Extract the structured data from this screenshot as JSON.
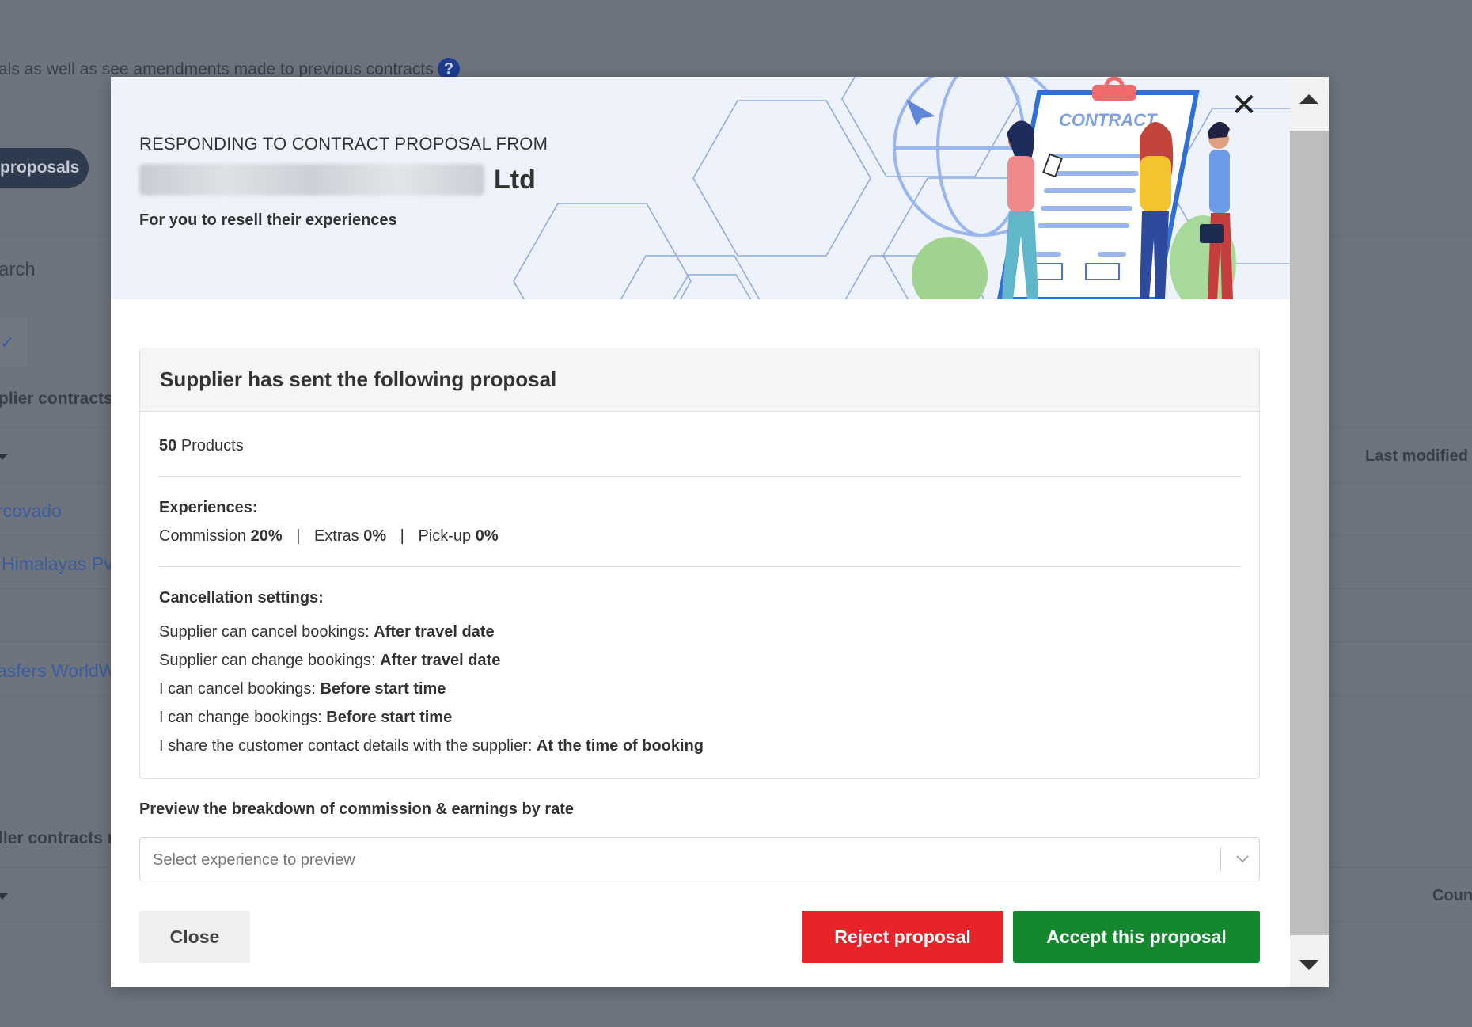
{
  "background": {
    "intro_text": "als as well as see amendments made to previous contracts",
    "help_glyph": "?",
    "proposals_pill": "proposals",
    "search_placeholder": "arch",
    "supplier_contracts_heading": "plier contracts",
    "reseller_contracts_heading": "ller contracts r",
    "last_modified_header": "Last modified",
    "country_header": "Coun",
    "rows": [
      "rcovado",
      "Himalayas Pvt",
      "asfers WorldWic"
    ]
  },
  "modal": {
    "heading": "RESPONDING TO CONTRACT PROPOSAL FROM",
    "company_suffix": "Ltd",
    "subheading": "For you to resell their experiences",
    "close_glyph": "✕",
    "illustration_label": "CONTRACT",
    "card": {
      "title": "Supplier has sent the following proposal",
      "product_count": "50",
      "product_label": "Products",
      "experiences_title": "Experiences:",
      "commission_label": "Commission",
      "commission_value": "20%",
      "extras_label": "Extras",
      "extras_value": "0%",
      "pickup_label": "Pick-up",
      "pickup_value": "0%",
      "separator": "|",
      "cancellation_title": "Cancellation settings:",
      "settings": [
        {
          "label": "Supplier can cancel bookings:",
          "value": "After travel date"
        },
        {
          "label": "Supplier can change bookings:",
          "value": "After travel date"
        },
        {
          "label": "I can cancel bookings:",
          "value": "Before start time"
        },
        {
          "label": "I can change bookings:",
          "value": "Before start time"
        },
        {
          "label": "I share the customer contact details with the supplier:",
          "value": "At the time of booking"
        }
      ]
    },
    "preview_label": "Preview the breakdown of commission & earnings by rate",
    "select_placeholder": "Select experience to preview",
    "buttons": {
      "close": "Close",
      "reject": "Reject proposal",
      "accept": "Accept this proposal"
    }
  },
  "colors": {
    "reject": "#e8242a",
    "accept": "#14872f",
    "banner": "#eef2fa"
  }
}
